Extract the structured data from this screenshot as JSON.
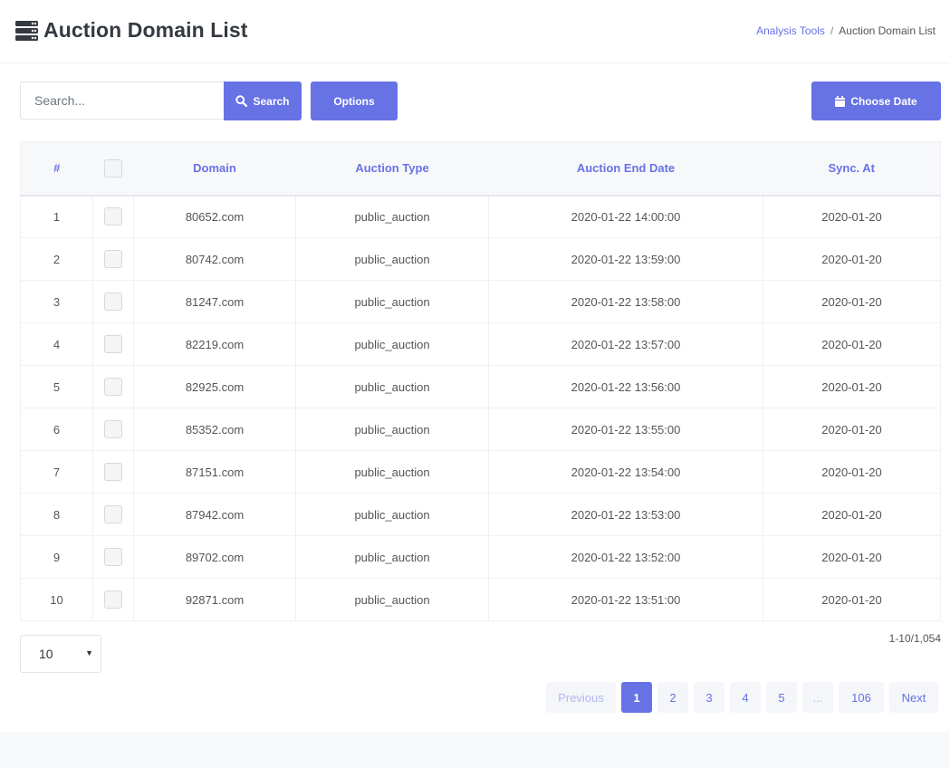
{
  "header": {
    "title": "Auction Domain List",
    "icon": "server-stack-icon",
    "breadcrumb": {
      "parent": "Analysis Tools",
      "separator": "/",
      "current": "Auction Domain List"
    }
  },
  "toolbar": {
    "search_placeholder": "Search...",
    "search_label": "Search",
    "options_label": "Options",
    "choose_date_label": "Choose Date"
  },
  "table": {
    "columns": [
      "#",
      "",
      "Domain",
      "Auction Type",
      "Auction End Date",
      "Sync. At"
    ],
    "rows": [
      {
        "num": "1",
        "domain": "80652.com",
        "type": "public_auction",
        "end": "2020-01-22 14:00:00",
        "sync": "2020-01-20"
      },
      {
        "num": "2",
        "domain": "80742.com",
        "type": "public_auction",
        "end": "2020-01-22 13:59:00",
        "sync": "2020-01-20"
      },
      {
        "num": "3",
        "domain": "81247.com",
        "type": "public_auction",
        "end": "2020-01-22 13:58:00",
        "sync": "2020-01-20"
      },
      {
        "num": "4",
        "domain": "82219.com",
        "type": "public_auction",
        "end": "2020-01-22 13:57:00",
        "sync": "2020-01-20"
      },
      {
        "num": "5",
        "domain": "82925.com",
        "type": "public_auction",
        "end": "2020-01-22 13:56:00",
        "sync": "2020-01-20"
      },
      {
        "num": "6",
        "domain": "85352.com",
        "type": "public_auction",
        "end": "2020-01-22 13:55:00",
        "sync": "2020-01-20"
      },
      {
        "num": "7",
        "domain": "87151.com",
        "type": "public_auction",
        "end": "2020-01-22 13:54:00",
        "sync": "2020-01-20"
      },
      {
        "num": "8",
        "domain": "87942.com",
        "type": "public_auction",
        "end": "2020-01-22 13:53:00",
        "sync": "2020-01-20"
      },
      {
        "num": "9",
        "domain": "89702.com",
        "type": "public_auction",
        "end": "2020-01-22 13:52:00",
        "sync": "2020-01-20"
      },
      {
        "num": "10",
        "domain": "92871.com",
        "type": "public_auction",
        "end": "2020-01-22 13:51:00",
        "sync": "2020-01-20"
      }
    ]
  },
  "footer": {
    "per_page": "10",
    "range": "1-10/1,054",
    "pagination": {
      "previous": "Previous",
      "pages": [
        "1",
        "2",
        "3",
        "4",
        "5"
      ],
      "ellipsis": "...",
      "last": "106",
      "next": "Next",
      "active": "1"
    }
  },
  "colors": {
    "accent": "#6772e5",
    "background": "#f8f9fb",
    "card": "#ffffff"
  }
}
